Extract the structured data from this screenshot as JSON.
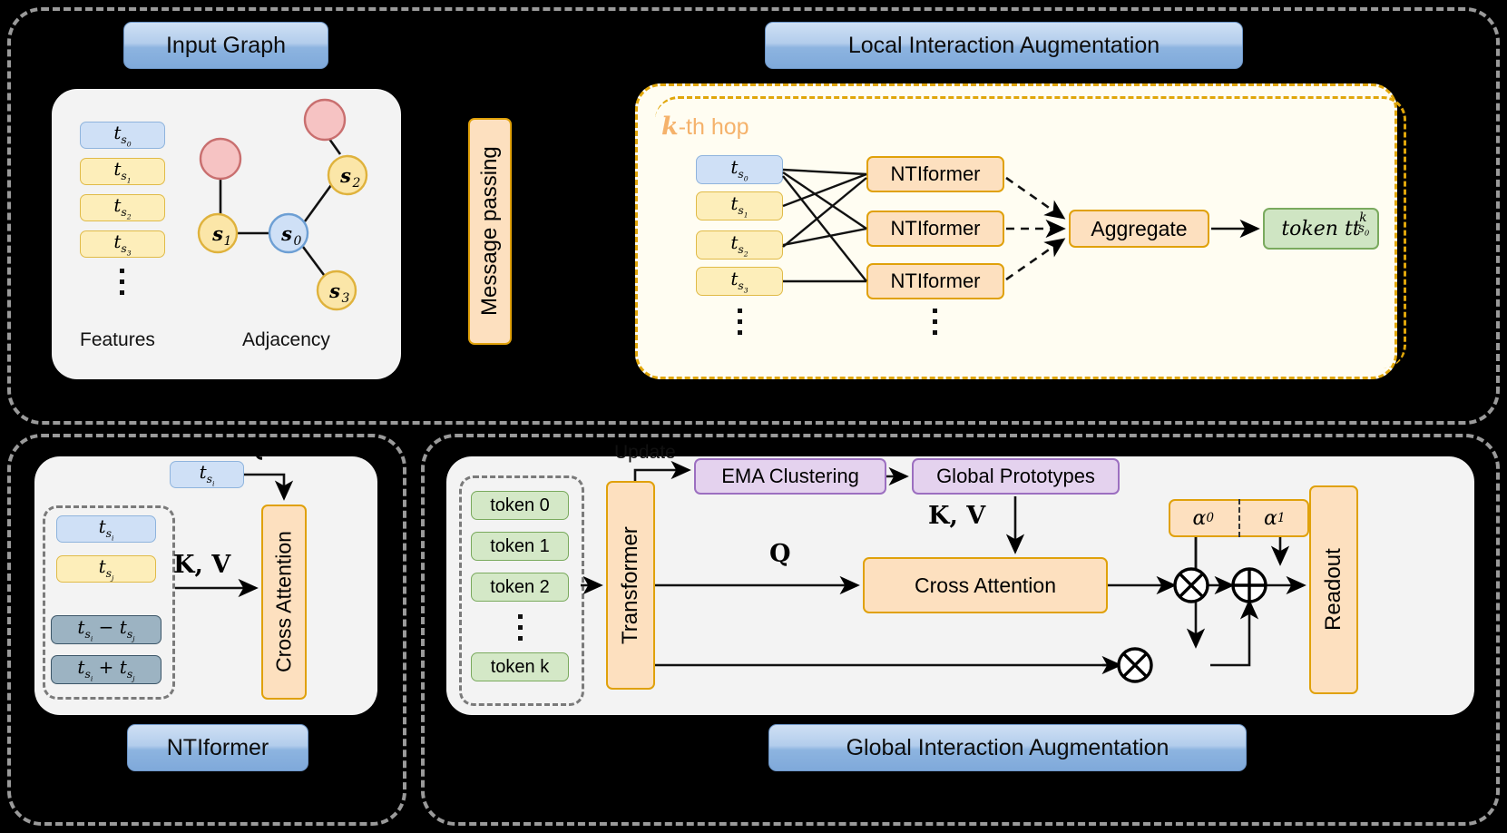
{
  "panels": {
    "input_graph": {
      "title": "Input Graph",
      "features_label": "Features",
      "adjacency_label": "Adjacency",
      "feature_boxes": [
        "t_s0",
        "t_s1",
        "t_s2",
        "t_s3"
      ],
      "nodes": [
        {
          "id": "s0",
          "label": "s0",
          "color": "#cfe0f6",
          "border": "#6d9fd4"
        },
        {
          "id": "s1",
          "label": "s1",
          "color": "#fbe6a8",
          "border": "#dfb23c"
        },
        {
          "id": "s2",
          "label": "s2",
          "color": "#fbe6a8",
          "border": "#dfb23c"
        },
        {
          "id": "s3",
          "label": "s3",
          "color": "#fbe6a8",
          "border": "#dfb23c"
        },
        {
          "id": "r1",
          "label": "",
          "color": "#f6c3c3",
          "border": "#c96f6f"
        },
        {
          "id": "r2",
          "label": "",
          "color": "#f6c3c3",
          "border": "#c96f6f"
        }
      ]
    },
    "message_passing": {
      "label": "Message passing"
    },
    "local": {
      "title": "Local Interaction Augmentation",
      "hop_k": "k",
      "hop_suffix": "-th hop",
      "inputs": [
        "t_s0",
        "t_s1",
        "t_s2",
        "t_s3"
      ],
      "ntiformers": [
        "NTIformer",
        "NTIformer",
        "NTIformer"
      ],
      "aggregate": "Aggregate",
      "output_token": "token t"
    },
    "ntiformer": {
      "title": "NTIformer",
      "query_box": "t_si",
      "q_label": "Q",
      "kv_label": "K, V",
      "kv_boxes": [
        "t_si",
        "t_sj",
        "t_si − t_sj",
        "t_si + t_sj"
      ],
      "cross_attention": "Cross Attention"
    },
    "global": {
      "title": "Global Interaction Augmentation",
      "tokens": [
        "token 0",
        "token 1",
        "token 2",
        "token k"
      ],
      "transformer": "Transformer",
      "update_label": "Update",
      "ema_clustering": "EMA Clustering",
      "global_prototypes": "Global Prototypes",
      "kv_label": "K, V",
      "q_label": "Q",
      "cross_attention": "Cross Attention",
      "alpha0": "α0",
      "alpha1": "α1",
      "readout": "Readout",
      "op_multiply": "⊗",
      "op_add": "⊕"
    }
  },
  "colors": {
    "background": "#000000",
    "panel_dash": "#9a9a9a",
    "card": "#f3f3f3",
    "cream": "#fffdf2",
    "amber": "#e0a60a",
    "title_blue": "#8db4e0",
    "token_green": "#d4e8c7",
    "purple": "#e4d2ee",
    "orange": "#fde0bf",
    "hop_orange": "#f5b26b"
  }
}
